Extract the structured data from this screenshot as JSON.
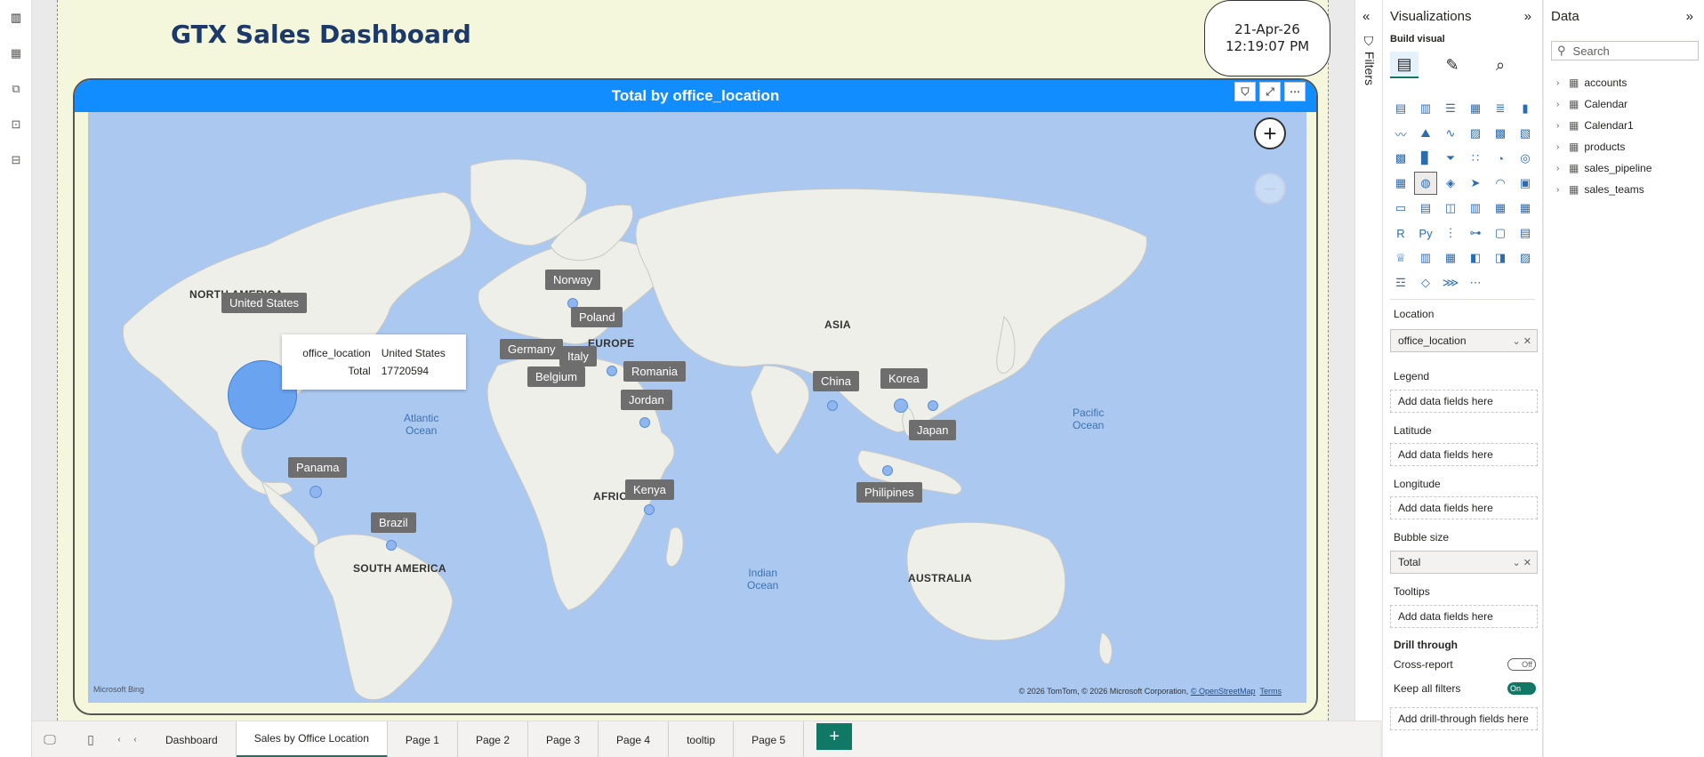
{
  "rail": {
    "icons": [
      "report-icon",
      "table-icon",
      "model-icon",
      "dax-query-icon",
      "tmdl-icon"
    ]
  },
  "report": {
    "title": "GTX Sales Dashboard",
    "date": "21-Apr-26",
    "time": "12:19:07 PM"
  },
  "map": {
    "title": "Total by office_location",
    "regions": {
      "north_america": "NORTH AMERICA",
      "south_america": "SOUTH AMERICA",
      "europe": "EUROPE",
      "asia": "ASIA",
      "africa": "AFRICA",
      "australia": "AUSTRALIA"
    },
    "oceans": {
      "atlantic": "Atlantic\nOcean",
      "pacific": "Pacific\nOcean",
      "indian": "Indian\nOcean"
    },
    "countries": {
      "united_states": "United States",
      "panama": "Panama",
      "brazil": "Brazil",
      "norway": "Norway",
      "poland": "Poland",
      "germany": "Germany",
      "italy": "Italy",
      "belgium": "Belgium",
      "romania": "Romania",
      "jordan": "Jordan",
      "kenya": "Kenya",
      "china": "China",
      "korea": "Korea",
      "japan": "Japan",
      "philipines": "Philipines"
    },
    "tooltip": {
      "field_key": "office_location",
      "field_value": "United States",
      "total_key": "Total",
      "total_value": "17720594"
    },
    "attribution": "© 2026 TomTom, © 2026 Microsoft Corporation,",
    "attribution_link": "© OpenStreetMap",
    "terms": "Terms",
    "bing": "Microsoft Bing"
  },
  "tabs": [
    {
      "label": "Dashboard",
      "active": false
    },
    {
      "label": "Sales by Office Location",
      "active": true
    },
    {
      "label": "Page 1",
      "active": false
    },
    {
      "label": "Page 2",
      "active": false
    },
    {
      "label": "Page 3",
      "active": false
    },
    {
      "label": "Page 4",
      "active": false
    },
    {
      "label": "tooltip",
      "active": false
    },
    {
      "label": "Page 5",
      "active": false
    }
  ],
  "add_tab": "+",
  "filters": {
    "label": "Filters"
  },
  "viz": {
    "title": "Visualizations",
    "build_label": "Build visual",
    "wells": {
      "location_label": "Location",
      "location_value": "office_location",
      "legend_label": "Legend",
      "latitude_label": "Latitude",
      "longitude_label": "Longitude",
      "bubble_label": "Bubble size",
      "bubble_value": "Total",
      "tooltips_label": "Tooltips",
      "placeholder": "Add data fields here"
    },
    "drill": {
      "label": "Drill through",
      "cross_report": "Cross-report",
      "cross_report_state": "Off",
      "keep_filters": "Keep all filters",
      "keep_filters_state": "On",
      "placeholder": "Add drill-through fields here"
    }
  },
  "data_pane": {
    "title": "Data",
    "search_placeholder": "Search",
    "tables": [
      "accounts",
      "Calendar",
      "Calendar1",
      "products",
      "sales_pipeline",
      "sales_teams"
    ]
  }
}
